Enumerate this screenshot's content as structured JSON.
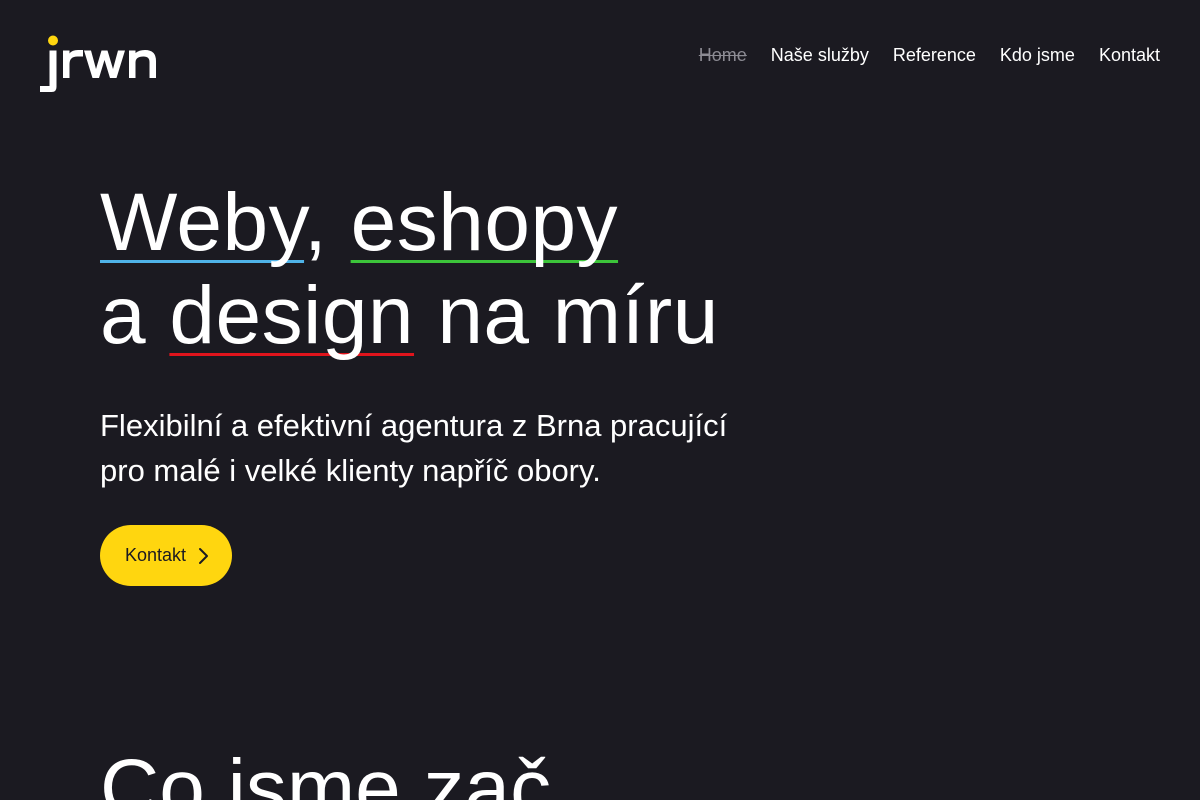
{
  "brand": {
    "logo_text": "jrwn",
    "accent_color": "#ffd60f",
    "background_color": "#1b1a21"
  },
  "nav": {
    "items": [
      {
        "label": "Home",
        "active": true
      },
      {
        "label": "Naše služby",
        "active": false
      },
      {
        "label": "Reference",
        "active": false
      },
      {
        "label": "Kdo jsme",
        "active": false
      },
      {
        "label": "Kontakt",
        "active": false
      }
    ]
  },
  "hero": {
    "title": {
      "word1": "Weby",
      "sep1": ", ",
      "word2": "eshopy",
      "line2_prefix": "a ",
      "word3": "design",
      "line2_suffix": " na míru"
    },
    "underline_colors": {
      "word1": "#4fb3e8",
      "word2": "#3cc43a",
      "word3": "#e0141c"
    },
    "subtitle_line1": "Flexibilní a efektivní agentura z Brna pracující",
    "subtitle_line2": "pro malé i velké klienty napříč obory.",
    "cta": {
      "label": "Kontakt",
      "icon": "chevron-right-icon"
    }
  },
  "section": {
    "title": "Co jsme zač"
  }
}
